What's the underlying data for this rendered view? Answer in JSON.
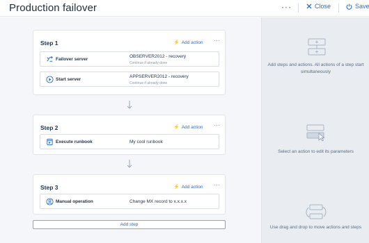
{
  "header": {
    "title": "Production failover",
    "more_label": "···",
    "close_label": "Close",
    "save_label": "Save"
  },
  "steps": [
    {
      "title": "Step 1",
      "add_action_label": "Add action",
      "more_label": "···",
      "actions": [
        {
          "icon": "failover-icon",
          "name": "Failover server",
          "param": "OBSERVER2012 - recovery",
          "sub": "Continue if already done"
        },
        {
          "icon": "play-icon",
          "name": "Start server",
          "param": "APPSERVER2012 - recovery",
          "sub": "Continue if already done"
        }
      ]
    },
    {
      "title": "Step 2",
      "add_action_label": "Add action",
      "more_label": "···",
      "actions": [
        {
          "icon": "runbook-icon",
          "name": "Execute runbook",
          "param": "My cool runbook"
        }
      ]
    },
    {
      "title": "Step 3",
      "add_action_label": "Add action",
      "more_label": "···",
      "actions": [
        {
          "icon": "user-icon",
          "name": "Manual operation",
          "param": "Change MX record to x.x.x.x"
        }
      ]
    }
  ],
  "add_step_label": "Add step",
  "hints": [
    "Add steps and actions. All actions of a step start simultaneously",
    "Select an action to edit its parameters",
    "Use drag and drop to move actions and steps"
  ],
  "colors": {
    "accent": "#2b6cc4",
    "canvas": "#f4f6f9",
    "panel": "#e9edf2"
  }
}
